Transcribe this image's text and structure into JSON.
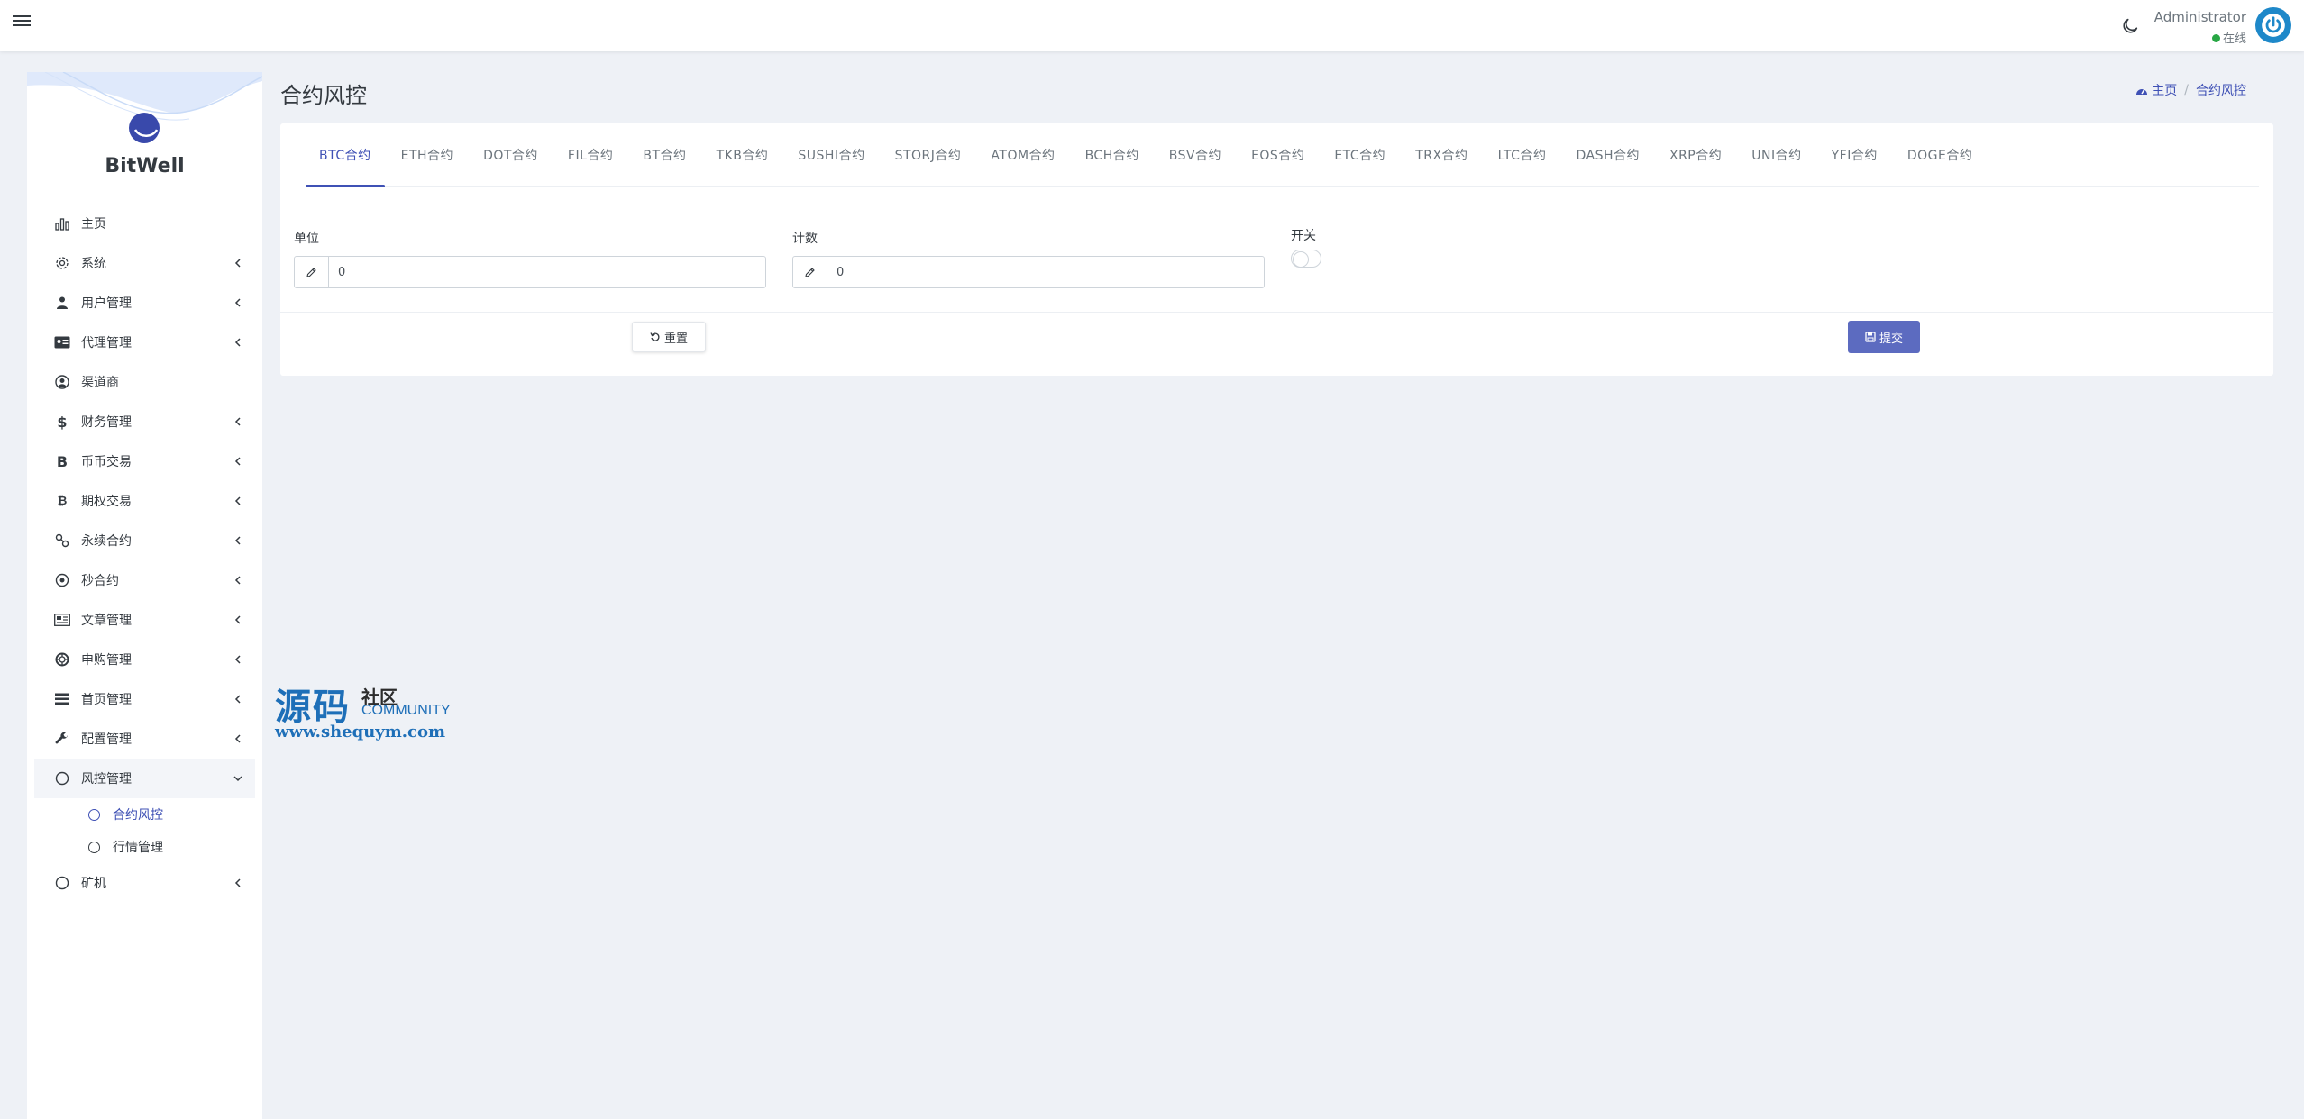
{
  "header": {
    "user_name": "Administrator",
    "user_status": "在线"
  },
  "brand": {
    "name": "BitWell"
  },
  "sidebar": {
    "items": [
      {
        "label": "主页",
        "icon": "bar-chart-icon"
      },
      {
        "label": "系统",
        "icon": "gear-icon"
      },
      {
        "label": "用户管理",
        "icon": "users-icon"
      },
      {
        "label": "代理管理",
        "icon": "id-card-icon"
      },
      {
        "label": "渠道商",
        "icon": "user-circle-icon"
      },
      {
        "label": "财务管理",
        "icon": "dollar-icon"
      },
      {
        "label": "币币交易",
        "icon": "bitcoin-icon"
      },
      {
        "label": "期权交易",
        "icon": "bitcoin-small-icon"
      },
      {
        "label": "永续合约",
        "icon": "link-icon"
      },
      {
        "label": "秒合约",
        "icon": "dot-circle-icon"
      },
      {
        "label": "文章管理",
        "icon": "newspaper-icon"
      },
      {
        "label": "申购管理",
        "icon": "life-ring-icon"
      },
      {
        "label": "首页管理",
        "icon": "list-icon"
      },
      {
        "label": "配置管理",
        "icon": "wrench-icon"
      },
      {
        "label": "风控管理",
        "icon": "circle-icon"
      }
    ],
    "sub_items": [
      {
        "label": "合约风控"
      },
      {
        "label": "行情管理"
      }
    ],
    "last_item": {
      "label": "矿机",
      "icon": "circle-icon"
    }
  },
  "page": {
    "title": "合约风控",
    "breadcrumb_home": "主页",
    "breadcrumb_current": "合约风控"
  },
  "tabs": [
    "BTC合约",
    "ETH合约",
    "DOT合约",
    "FIL合约",
    "BT合约",
    "TKB合约",
    "SUSHI合约",
    "STORJ合约",
    "ATOM合约",
    "BCH合约",
    "BSV合约",
    "EOS合约",
    "ETC合约",
    "TRX合约",
    "LTC合约",
    "DASH合约",
    "XRP合约",
    "UNI合约",
    "YFI合约",
    "DOGE合约"
  ],
  "form": {
    "unit_label": "单位",
    "unit_value": "0",
    "count_label": "计数",
    "count_value": "0",
    "switch_label": "开关",
    "reset_label": "重置",
    "submit_label": "提交"
  },
  "watermark": {
    "big": "源码",
    "small1": "社区",
    "small2": "COMMUNITY",
    "url": "www.shequym.com"
  },
  "colors": {
    "accent": "#3f51b5",
    "submit": "#5c6bc0",
    "online": "#28a745",
    "avatar": "#1e88c9"
  }
}
